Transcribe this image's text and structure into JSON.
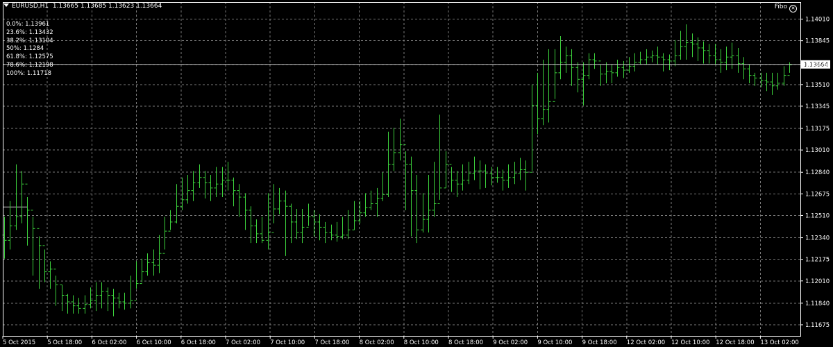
{
  "header": {
    "symbol": "EURUSD,H1",
    "ohlc": "1.13665 1.13685 1.13623 1.13664"
  },
  "fibo": {
    "tag": "Fibo",
    "levels": [
      {
        "label": "0.0%: 1.13961",
        "price": 1.13961
      },
      {
        "label": "23.6%: 1.13432",
        "price": 1.13432
      },
      {
        "label": "38.2%: 1.13104",
        "price": 1.13104
      },
      {
        "label": "50%: 1.1284",
        "price": 1.1284
      },
      {
        "label": "61.8%: 1.12575",
        "price": 1.12575
      },
      {
        "label": "78.6%: 1.12198",
        "price": 1.12198
      },
      {
        "label": "100%: 1.11718",
        "price": 1.11718
      }
    ]
  },
  "colors": {
    "bars": "#3cd23c",
    "grid": "#7a7a7a",
    "background": "#000000",
    "text": "#ffffff"
  },
  "chart_data": {
    "type": "ohlc",
    "title": "EURUSD,H1",
    "ylim": [
      1.1159,
      1.1414
    ],
    "y_ticks": [
      "1.14010",
      "1.13845",
      "1.13664",
      "1.13510",
      "1.13345",
      "1.13175",
      "1.13010",
      "1.12840",
      "1.12675",
      "1.12510",
      "1.12340",
      "1.12175",
      "1.12010",
      "1.11840",
      "1.11675"
    ],
    "current_price": "1.13664",
    "x_ticks": [
      "5 Oct 2015",
      "5 Oct 18:00",
      "6 Oct 02:00",
      "6 Oct 10:00",
      "6 Oct 18:00",
      "7 Oct 02:00",
      "7 Oct 10:00",
      "7 Oct 18:00",
      "8 Oct 02:00",
      "8 Oct 10:00",
      "8 Oct 18:00",
      "9 Oct 02:00",
      "9 Oct 10:00",
      "9 Oct 18:00",
      "12 Oct 02:00",
      "12 Oct 10:00",
      "12 Oct 18:00",
      "13 Oct 02:00"
    ],
    "close": [
      1.1232,
      1.1243,
      1.125,
      1.1275,
      1.1255,
      1.1241,
      1.1228,
      1.1208,
      1.121,
      1.1198,
      1.119,
      1.1185,
      1.1182,
      1.118,
      1.1183,
      1.1186,
      1.119,
      1.1193,
      1.119,
      1.1188,
      1.1185,
      1.1184,
      1.1186,
      1.1199,
      1.1208,
      1.1215,
      1.1213,
      1.1222,
      1.1239,
      1.1246,
      1.1258,
      1.1263,
      1.127,
      1.1276,
      1.128,
      1.1276,
      1.1272,
      1.1275,
      1.1278,
      1.1278,
      1.127,
      1.1265,
      1.1255,
      1.1243,
      1.1237,
      1.1232,
      1.1238,
      1.1256,
      1.1262,
      1.1258,
      1.1246,
      1.1238,
      1.1242,
      1.125,
      1.1246,
      1.1242,
      1.1238,
      1.1236,
      1.1235,
      1.1236,
      1.124,
      1.1247,
      1.1253,
      1.1257,
      1.126,
      1.1264,
      1.1267,
      1.129,
      1.1299,
      1.1305,
      1.129,
      1.127,
      1.124,
      1.1248,
      1.1255,
      1.126,
      1.1272,
      1.129,
      1.1278,
      1.1275,
      1.1278,
      1.1283,
      1.1285,
      1.1285,
      1.1283,
      1.128,
      1.128,
      1.1278,
      1.128,
      1.1283,
      1.1286,
      1.1284,
      1.1335,
      1.1325,
      1.1332,
      1.1338,
      1.136,
      1.1368,
      1.1373,
      1.1364,
      1.1355,
      1.1358,
      1.137,
      1.1369,
      1.1359,
      1.1361,
      1.136,
      1.1364,
      1.1362,
      1.1365,
      1.1368,
      1.137,
      1.1372,
      1.1373,
      1.1372,
      1.137,
      1.1369,
      1.1373,
      1.138,
      1.1383,
      1.1382,
      1.1379,
      1.1377,
      1.1373,
      1.137,
      1.1368,
      1.1372,
      1.1373,
      1.1367,
      1.1363,
      1.1358,
      1.1356,
      1.1354,
      1.1353,
      1.135,
      1.1352,
      1.1358,
      1.1366
    ],
    "high": [
      1.125,
      1.1262,
      1.129,
      1.1285,
      1.1265,
      1.125,
      1.1235,
      1.1225,
      1.1216,
      1.1205,
      1.1198,
      1.1191,
      1.119,
      1.1188,
      1.119,
      1.1196,
      1.12,
      1.12,
      1.1196,
      1.1195,
      1.1192,
      1.1192,
      1.1205,
      1.1216,
      1.1218,
      1.1222,
      1.1225,
      1.1236,
      1.125,
      1.1255,
      1.1275,
      1.128,
      1.1282,
      1.1285,
      1.129,
      1.1285,
      1.1282,
      1.1288,
      1.1288,
      1.1292,
      1.128,
      1.1275,
      1.1268,
      1.1258,
      1.1248,
      1.125,
      1.1268,
      1.1275,
      1.1272,
      1.127,
      1.126,
      1.1256,
      1.1256,
      1.126,
      1.1255,
      1.1252,
      1.1246,
      1.1244,
      1.1246,
      1.125,
      1.1255,
      1.1262,
      1.1262,
      1.1268,
      1.127,
      1.1272,
      1.1284,
      1.1315,
      1.1318,
      1.1325,
      1.13,
      1.1296,
      1.1282,
      1.1268,
      1.1282,
      1.1292,
      1.1328,
      1.13,
      1.1288,
      1.1285,
      1.129,
      1.1292,
      1.1296,
      1.1293,
      1.129,
      1.1288,
      1.1288,
      1.1286,
      1.129,
      1.1292,
      1.1295,
      1.1293,
      1.1351,
      1.136,
      1.137,
      1.1378,
      1.1378,
      1.1388,
      1.138,
      1.1378,
      1.1368,
      1.1368,
      1.1375,
      1.1375,
      1.1366,
      1.1368,
      1.1366,
      1.137,
      1.1369,
      1.1372,
      1.1375,
      1.1376,
      1.1378,
      1.1377,
      1.138,
      1.1375,
      1.1374,
      1.1385,
      1.1392,
      1.1397,
      1.139,
      1.1387,
      1.1384,
      1.1382,
      1.1382,
      1.1378,
      1.138,
      1.1383,
      1.1379,
      1.1372,
      1.1366,
      1.136,
      1.136,
      1.136,
      1.136,
      1.136,
      1.1365,
      1.1368
    ],
    "low": [
      1.1218,
      1.1225,
      1.124,
      1.1245,
      1.1228,
      1.1205,
      1.1195,
      1.12,
      1.1195,
      1.1182,
      1.1178,
      1.1176,
      1.1176,
      1.1176,
      1.1176,
      1.118,
      1.1178,
      1.118,
      1.1178,
      1.1174,
      1.118,
      1.1179,
      1.118,
      1.1195,
      1.12,
      1.1205,
      1.1205,
      1.1207,
      1.1225,
      1.124,
      1.1245,
      1.1255,
      1.126,
      1.1262,
      1.1272,
      1.1264,
      1.1262,
      1.1265,
      1.1265,
      1.127,
      1.1258,
      1.125,
      1.124,
      1.123,
      1.123,
      1.123,
      1.1225,
      1.1245,
      1.1252,
      1.122,
      1.123,
      1.1233,
      1.123,
      1.1243,
      1.1235,
      1.1232,
      1.123,
      1.1232,
      1.1231,
      1.1233,
      1.1233,
      1.124,
      1.1245,
      1.125,
      1.1255,
      1.125,
      1.1262,
      1.1265,
      1.1285,
      1.1293,
      1.1255,
      1.1235,
      1.123,
      1.1238,
      1.1238,
      1.125,
      1.1263,
      1.1272,
      1.1269,
      1.1265,
      1.127,
      1.1275,
      1.1278,
      1.1271,
      1.1272,
      1.1274,
      1.1276,
      1.127,
      1.1272,
      1.1275,
      1.1278,
      1.127,
      1.1285,
      1.1313,
      1.132,
      1.1322,
      1.134,
      1.1355,
      1.136,
      1.135,
      1.1345,
      1.1335,
      1.1355,
      1.1363,
      1.135,
      1.1352,
      1.1352,
      1.1357,
      1.1356,
      1.136,
      1.1361,
      1.1366,
      1.1366,
      1.1368,
      1.1366,
      1.1361,
      1.1362,
      1.1365,
      1.137,
      1.137,
      1.1372,
      1.1369,
      1.1367,
      1.1367,
      1.1366,
      1.136,
      1.1362,
      1.1363,
      1.136,
      1.1355,
      1.1352,
      1.135,
      1.1349,
      1.1346,
      1.1343,
      1.1347,
      1.135,
      1.136
    ]
  }
}
